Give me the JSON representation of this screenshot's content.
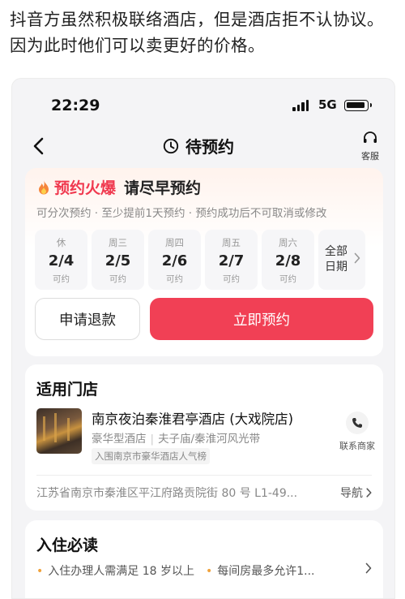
{
  "post": {
    "text": "抖音方虽然积极联络酒店，但是酒店拒不认协议。 因为此时他们可以卖更好的价格。"
  },
  "status_bar": {
    "time": "22:29",
    "network": "5G"
  },
  "nav": {
    "title": "待预约",
    "service_label": "客服"
  },
  "booking": {
    "hot_label": "预约火爆",
    "hurry_label": "请尽早预约",
    "rules": "可分次预约 · 至少提前1天预约 · 预约成功后不可取消或修改",
    "dates": [
      {
        "weekday": "休",
        "date": "2/4",
        "status": "可约"
      },
      {
        "weekday": "周三",
        "date": "2/5",
        "status": "可约"
      },
      {
        "weekday": "周四",
        "date": "2/6",
        "status": "可约"
      },
      {
        "weekday": "周五",
        "date": "2/7",
        "status": "可约"
      },
      {
        "weekday": "周六",
        "date": "2/8",
        "status": "可约"
      }
    ],
    "all_dates_label": "全部日期",
    "refund_button": "申请退款",
    "book_button": "立即预约"
  },
  "store": {
    "heading": "适用门店",
    "name": "南京夜泊秦淮君亭酒店 (大戏院店)",
    "category": "豪华型酒店",
    "area": "夫子庙/秦淮河风光带",
    "rank_badge": "入围南京市豪华酒店人气榜",
    "contact_label": "联系商家",
    "address": "江苏省南京市秦淮区平江府路贡院街 80 号 L1-49...",
    "navigate_label": "导航"
  },
  "checkin": {
    "heading": "入住必读",
    "items": [
      "入住办理人需满足 18 岁以上",
      "每间房最多允许1..."
    ]
  },
  "colors": {
    "accent": "#f14055",
    "hot": "#f0394f",
    "bullet": "#f0a23b"
  },
  "icons": [
    "back-chevron-icon",
    "clock-icon",
    "headset-icon",
    "flame-icon",
    "chevron-right-icon",
    "phone-icon"
  ]
}
